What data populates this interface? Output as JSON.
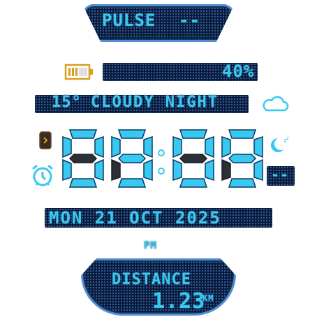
{
  "top": {
    "label": "PULSE",
    "value": "--"
  },
  "battery": {
    "percent_text": "40%",
    "level": 0.4
  },
  "weather": {
    "temp": "15°",
    "condition": "CLOUDY NIGHT",
    "icon": "cloud-icon"
  },
  "time": {
    "h1": "0",
    "h2": "9",
    "m1": "0",
    "m2": "9",
    "seconds": "--",
    "ampm": "PM"
  },
  "left_icons": {
    "phone": "phone-icon",
    "alarm": "alarm-clock-icon"
  },
  "right_icons": {
    "sleep": "moon-sleep-icon"
  },
  "date": {
    "text": "MON 21 OCT 2025"
  },
  "bottom": {
    "label": "DISTANCE",
    "value": "1.23",
    "unit": "KM"
  },
  "colors": {
    "accent": "#38c8f0",
    "panel": "#0a1a3a",
    "ghost": "#2a2f38",
    "border": "#4f8fd6"
  }
}
